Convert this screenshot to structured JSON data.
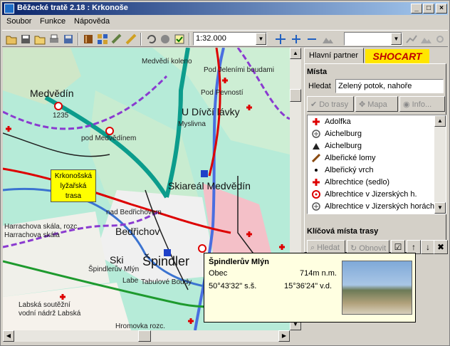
{
  "window": {
    "title": "Běžecké tratě 2.18 : Krkonoše",
    "minimize": "_",
    "maximize": "□",
    "close": "×"
  },
  "menu": [
    "Soubor",
    "Funkce",
    "Nápověda"
  ],
  "toolbar": {
    "scale": "1:32.000",
    "icons": [
      "open-folder-icon",
      "save-icon",
      "print-icon",
      "book-icon",
      "grid-icon",
      "ruler-icon",
      "pencil-icon",
      "undo-icon",
      "stop-icon",
      "check-icon",
      "zoom-icon",
      "zoom-in-icon",
      "zoom-out-icon",
      "terrain-icon"
    ]
  },
  "map": {
    "labels": {
      "medvedin": "Medvědín",
      "height": "1235",
      "pod_medvedinem": "pod Medvědínem",
      "medvedi_koleno": "Medvědí koleno",
      "pod_jelenimi": "Pod Jeleními boudami",
      "pod_pevnosti": "Pod Pevností",
      "u_divci": "U Dívčí lávky",
      "mysliva": "Myslivna",
      "skiareal": "Skiareál Medvědín",
      "nad_bedrichovem": "nad Bedřichovem",
      "bedrichov": "Bedřichov",
      "harrachova1": "Harrachova skála, rozc.",
      "harrachova2": "Harrachova skála",
      "spindler": "Špindlerův Mlýn",
      "spindler_short": "Špindler",
      "tabulove": "Tabulové Boudy",
      "labska_sevemi": "Labská soutěžní",
      "labska": "vodní nádrž Labská",
      "hromovka": "Hromovka rozc.",
      "labe": "Labe",
      "ski": "Ski"
    },
    "callout": {
      "l1": "Krkonošská",
      "l2": "lyžařská",
      "l3": "trasa"
    }
  },
  "side": {
    "tab_partner": "Hlavní partner",
    "brand": "SHOCART",
    "mista_title": "Místa",
    "search_label": "Hledat",
    "search_value": "Zelený potok, nahoře",
    "btn_do_trasy": "Do trasy",
    "btn_mapa": "Mapa",
    "btn_info": "Info...",
    "places": [
      {
        "name": "Adolfka",
        "icon": "red-cross-icon"
      },
      {
        "name": "Aichelburg",
        "icon": "ruin-icon"
      },
      {
        "name": "Aichelburg",
        "icon": "mountain-icon"
      },
      {
        "name": "Albeřické lomy",
        "icon": "quarry-icon"
      },
      {
        "name": "Albeřický vrch",
        "icon": "peak-icon"
      },
      {
        "name": "Albrechtice (sedlo)",
        "icon": "red-cross-icon"
      },
      {
        "name": "Albrechtice v Jizerských h.",
        "icon": "town-icon"
      },
      {
        "name": "Albrechtice v Jizerských horách",
        "icon": "ruin-icon"
      }
    ],
    "route_title": "Klíčová místa trasy",
    "btn_hledat": "Hledat",
    "btn_obnovit": "Obnovit"
  },
  "popup": {
    "name": "Špindlerův Mlýn",
    "type": "Obec",
    "altitude": "714m n.m.",
    "lat": "50°43'32\" s.š.",
    "lon": "15°36'24\" v.d."
  }
}
